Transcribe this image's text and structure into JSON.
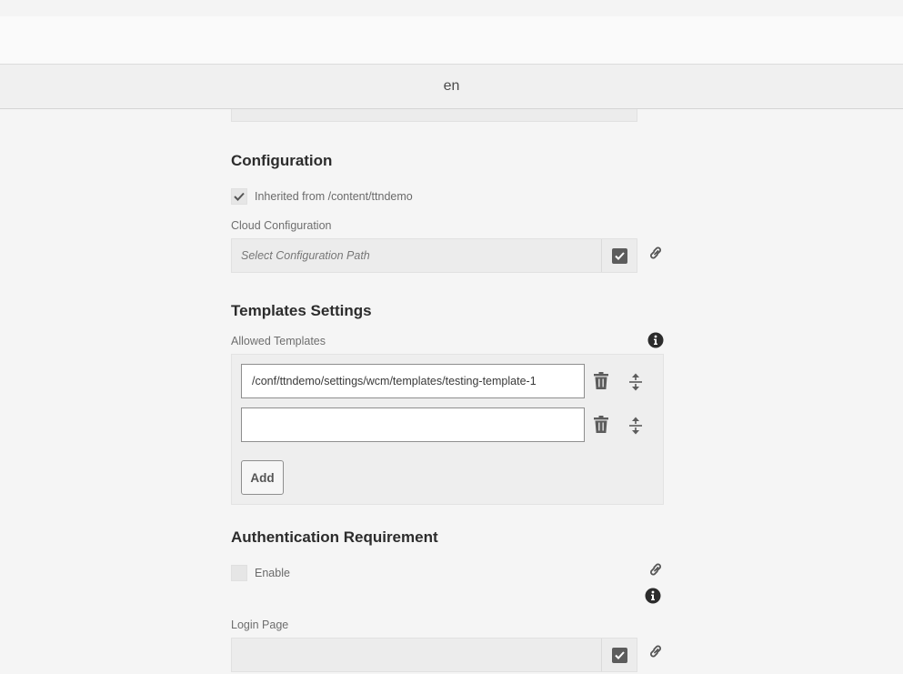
{
  "header": {
    "title": "en"
  },
  "configuration": {
    "heading": "Configuration",
    "inherited_label": "Inherited from /content/ttndemo",
    "cloud_label": "Cloud Configuration",
    "cloud_placeholder": "Select Configuration Path"
  },
  "templates": {
    "heading": "Templates Settings",
    "allowed_label": "Allowed Templates",
    "items": [
      {
        "value": "/conf/ttndemo/settings/wcm/templates/testing-template-1"
      },
      {
        "value": ""
      }
    ],
    "add_label": "Add"
  },
  "authentication": {
    "heading": "Authentication Requirement",
    "enable_label": "Enable",
    "enabled": false,
    "login_label": "Login Page",
    "login_placeholder": ""
  },
  "icons": {
    "check": "checkmark-icon",
    "picker": "select-checkbox-icon",
    "link": "link-icon",
    "info": "info-icon",
    "delete": "trash-icon",
    "reorder": "reorder-icon"
  },
  "colors": {
    "background": "#f5f5f5",
    "field": "#ececec",
    "icon": "#5c5c5c",
    "heading": "#2c2c2c"
  }
}
